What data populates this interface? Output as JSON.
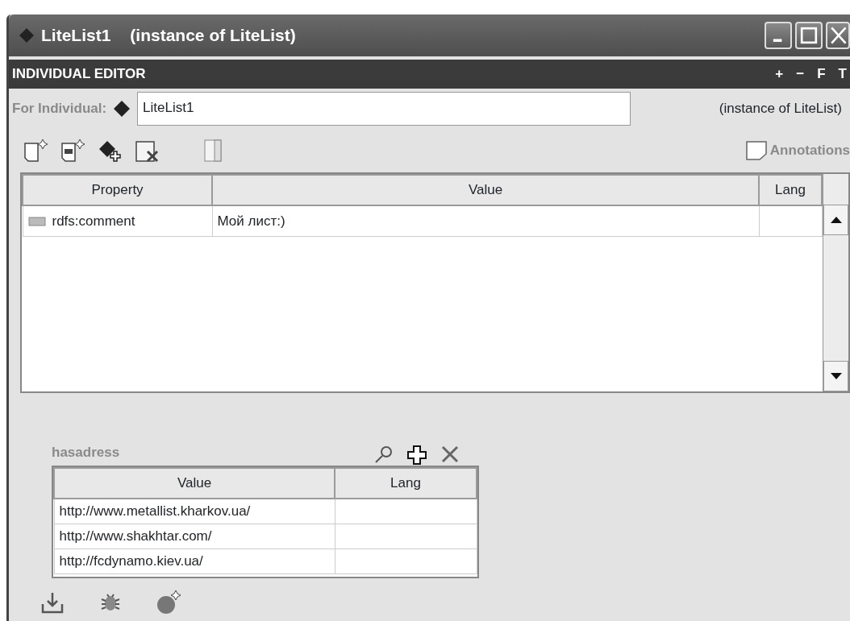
{
  "window": {
    "title": "LiteList1",
    "subtitle": "(instance of LiteList)"
  },
  "editor": {
    "title": "INDIVIDUAL EDITOR",
    "tools": [
      "+",
      "−",
      "F",
      "T"
    ]
  },
  "individual": {
    "label": "For Individual:",
    "value": "LiteList1",
    "instance_of": "(instance of LiteList)"
  },
  "annotations": {
    "label": "Annotations"
  },
  "properties": {
    "columns": [
      "Property",
      "Value",
      "Lang"
    ],
    "rows": [
      {
        "property": "rdfs:comment",
        "value": "Мой лист:)"
      }
    ]
  },
  "hasadress": {
    "title": "hasadress",
    "columns": [
      "Value",
      "Lang"
    ],
    "rows": [
      {
        "value": "http://www.metallist.kharkov.ua/"
      },
      {
        "value": "http://www.shakhtar.com/"
      },
      {
        "value": "http://fcdynamo.kiev.ua/"
      }
    ]
  }
}
